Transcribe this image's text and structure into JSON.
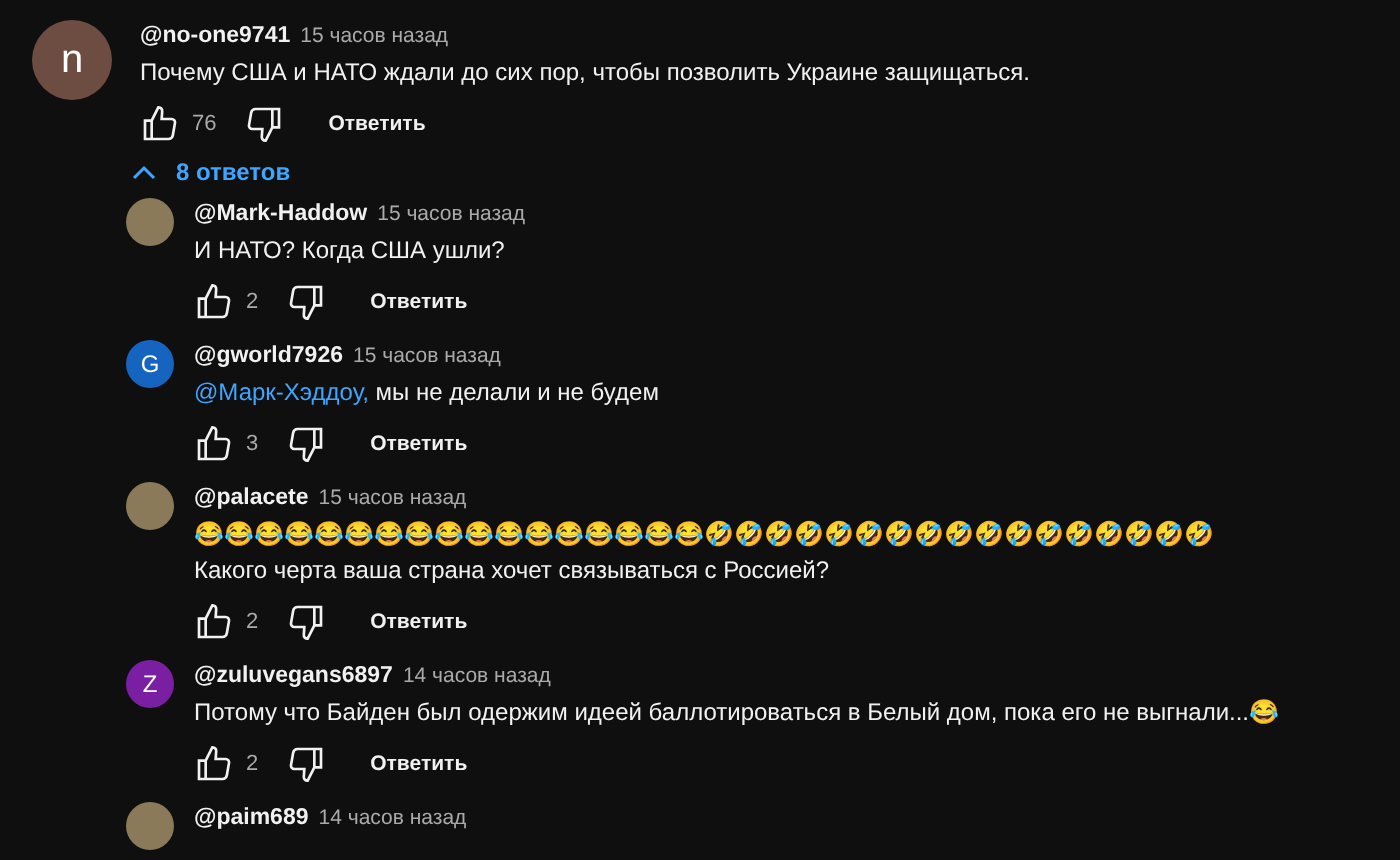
{
  "comment": {
    "author": "@no-one9741",
    "time": "15 часов назад",
    "avatar": {
      "kind": "letter",
      "letter": "n",
      "color": "#6d4c41"
    },
    "text": "Почему США и НАТО ждали до сих пор, чтобы позволить Украине защищаться.",
    "likes": "76",
    "reply": "Ответить"
  },
  "replies_toggle": {
    "label": "8 ответов",
    "expanded": true
  },
  "replies": [
    {
      "author": "@Mark-Haddow",
      "time": "15 часов назад",
      "avatar": {
        "kind": "photo"
      },
      "text": "И НАТО? Когда США ушли?",
      "likes": "2",
      "reply": "Ответить"
    },
    {
      "author": "@gworld7926",
      "time": "15 часов назад",
      "avatar": {
        "kind": "letter",
        "letter": "G",
        "color": "#1565c0"
      },
      "mention": "@Марк-Хэддоу,",
      "text": "мы не делали и не будем",
      "likes": "3",
      "reply": "Ответить"
    },
    {
      "author": "@palacete",
      "time": "15 часов назад",
      "avatar": {
        "kind": "photo"
      },
      "text": "😂😂😂😂😂😂😂😂😂😂😂😂😂😂😂😂😂🤣🤣🤣🤣🤣🤣🤣🤣🤣🤣🤣🤣🤣🤣🤣🤣🤣\nКакого черта ваша страна хочет связываться с Россией?",
      "likes": "2",
      "reply": "Ответить"
    },
    {
      "author": "@zuluvegans6897",
      "time": "14 часов назад",
      "avatar": {
        "kind": "letter",
        "letter": "Z",
        "color": "#7b1fa2"
      },
      "text": "Потому что Байден был одержим идеей баллотироваться в Белый дом, пока его не выгнали...😂",
      "likes": "2",
      "reply": "Ответить"
    },
    {
      "author": "@paim689",
      "time": "14 часов назад",
      "avatar": {
        "kind": "photo"
      }
    }
  ]
}
